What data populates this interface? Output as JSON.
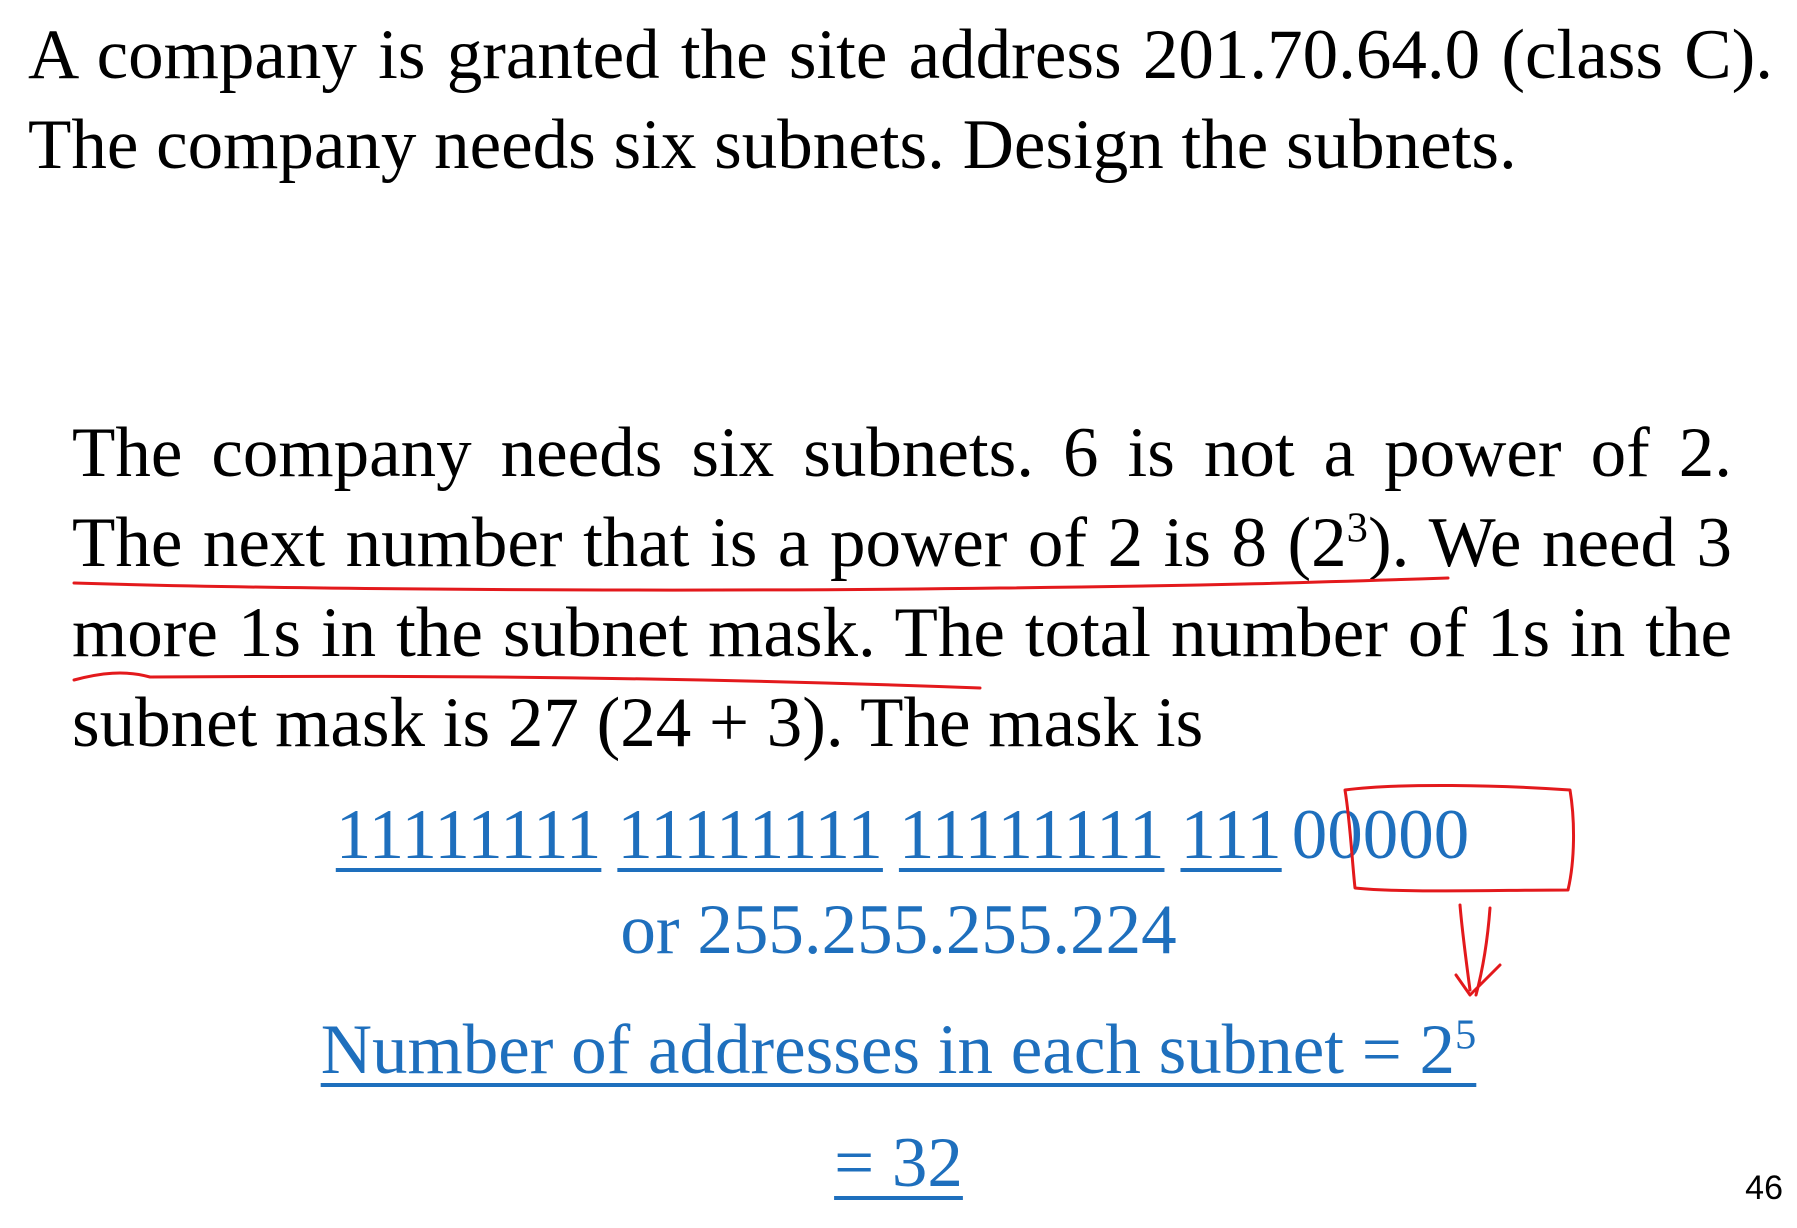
{
  "problem": {
    "text": "A company is granted the site address 201.70.64.0 (class C). The company needs six subnets. Design the subnets."
  },
  "explanation": {
    "part1": "The company needs six subnets. 6 is not a power of 2. The next number that is a power of 2 is 8 (2",
    "exp1": "3",
    "part2": "). We need 3 more 1s in the subnet mask. The total number of 1s in the subnet mask is 27 (24 + 3). The mask is"
  },
  "mask": {
    "octet1": "11111111",
    "octet2": "11111111",
    "octet3": "11111111",
    "octet4_network": "111",
    "octet4_host": "00000",
    "decimal": "or 255.255.255.224"
  },
  "addresses": {
    "label": "Number of addresses in each subnet = 2",
    "exponent": "5",
    "result": "= 32"
  },
  "page_number": "46",
  "colors": {
    "text": "#000000",
    "blue_text": "#1e6fbd",
    "annotation_red": "#e3191c"
  }
}
